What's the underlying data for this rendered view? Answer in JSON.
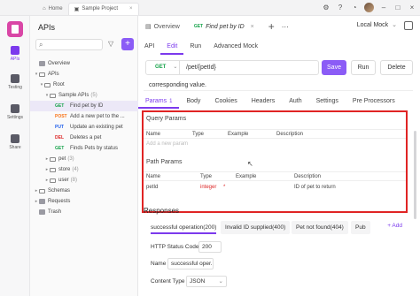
{
  "window": {
    "tabs": [
      {
        "label": "Home"
      },
      {
        "label": "Sample Project"
      }
    ]
  },
  "rail": {
    "items": [
      {
        "label": "APIs",
        "active": true
      },
      {
        "label": "Testing"
      },
      {
        "label": "Settings"
      },
      {
        "label": "Share"
      }
    ]
  },
  "sidebar": {
    "title": "APIs",
    "tree": [
      {
        "label": "Overview",
        "indent": 0,
        "kind": "doc"
      },
      {
        "label": "APIs",
        "indent": 0,
        "kind": "folder",
        "chev": "v"
      },
      {
        "label": "Root",
        "indent": 1,
        "kind": "folder",
        "chev": "v"
      },
      {
        "label": "Sample APIs",
        "count": "(5)",
        "indent": 2,
        "kind": "folder",
        "chev": "v"
      },
      {
        "method": "GET",
        "label": "Find pet by ID",
        "indent": 3,
        "selected": true
      },
      {
        "method": "POST",
        "label": "Add a new pet to the ...",
        "indent": 3
      },
      {
        "method": "PUT",
        "label": "Update an existing pet",
        "indent": 3
      },
      {
        "method": "DEL",
        "label": "Deletes a pet",
        "indent": 3
      },
      {
        "method": "GET",
        "label": "Finds Pets by status",
        "indent": 3
      },
      {
        "label": "pet",
        "count": "(3)",
        "indent": 2,
        "kind": "folder",
        "chev": ">"
      },
      {
        "label": "store",
        "count": "(4)",
        "indent": 2,
        "kind": "folder",
        "chev": ">"
      },
      {
        "label": "user",
        "count": "(8)",
        "indent": 2,
        "kind": "folder",
        "chev": ">"
      },
      {
        "label": "Schemas",
        "indent": 0,
        "kind": "folder",
        "chev": ">"
      },
      {
        "label": "Requests",
        "indent": 0,
        "kind": "doc",
        "chev": ">"
      },
      {
        "label": "Trash",
        "indent": 0,
        "kind": "doc"
      }
    ]
  },
  "doc_tabs": {
    "overview": "Overview",
    "active_method": "GET",
    "active_title": "Find pet by ID",
    "environment": "Local Mock"
  },
  "sub_tabs": [
    "API",
    "Edit",
    "Run",
    "Advanced Mock"
  ],
  "request": {
    "method": "GET",
    "path": "/pet/{petId}",
    "save": "Save",
    "run": "Run",
    "delete": "Delete",
    "description": "corresponding value."
  },
  "req_tabs": [
    {
      "label": "Params",
      "count": "1",
      "active": true
    },
    {
      "label": "Body"
    },
    {
      "label": "Cookies"
    },
    {
      "label": "Headers"
    },
    {
      "label": "Auth"
    },
    {
      "label": "Settings"
    },
    {
      "label": "Pre Processors"
    }
  ],
  "params": {
    "query_title": "Query Params",
    "query_headers": [
      "Name",
      "Type",
      "Example",
      "Description"
    ],
    "query_placeholder": "Add a new param",
    "path_title": "Path Params",
    "path_headers": [
      "Name",
      "Type",
      "Example",
      "Description"
    ],
    "path_row": {
      "name": "petId",
      "type": "integer",
      "required": "*",
      "description": "ID of pet to return"
    }
  },
  "responses": {
    "title": "Responses",
    "tabs": [
      {
        "label": "successful operation(200)",
        "active": true
      },
      {
        "label": "Invalid ID supplied(400)"
      },
      {
        "label": "Pet not found(404)"
      },
      {
        "label": "Pub"
      }
    ],
    "add": "+ Add",
    "status_label": "HTTP Status Code",
    "status_value": "200",
    "name_label": "Name",
    "name_value": "successful oper.",
    "content_label": "Content Type",
    "content_value": "JSON"
  },
  "colors": {
    "accent": "#8b5cf6",
    "highlight": "#e02424",
    "get": "#16a34a"
  }
}
